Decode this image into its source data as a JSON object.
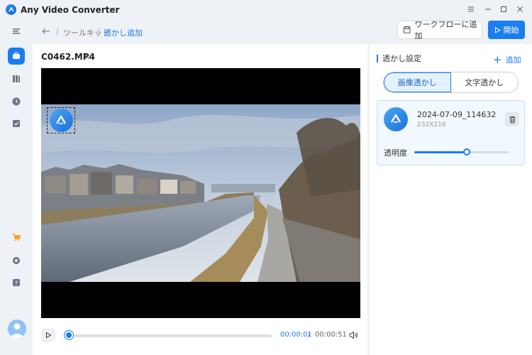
{
  "app": {
    "title": "Any Video Converter"
  },
  "header": {
    "breadcrumb": [
      "ツールキット",
      "透かし追加"
    ],
    "breadcrumb_sep": "/",
    "workflow_label": "ワークフローに追加",
    "start_label": "開始"
  },
  "editor": {
    "file_name": "C0462.MP4",
    "close_glyph": "×",
    "time_current": "00:00:01",
    "time_sep": "/",
    "time_total": "00:00:51",
    "progress": 0.02
  },
  "panel": {
    "title": "透かし設定",
    "add_label": "追加",
    "tabs": [
      {
        "label": "画像透かし",
        "active": true
      },
      {
        "label": "文字透かし",
        "active": false
      }
    ],
    "watermark": {
      "name": "2024-07-09_114632",
      "size": "232X218",
      "opacity_label": "透明度",
      "opacity": 0.56
    }
  },
  "colors": {
    "accent": "#1a7df0",
    "bg": "#eef1f6"
  },
  "icons": [
    "menu-icon",
    "toolbox-icon",
    "library-icon",
    "history-icon",
    "task-icon",
    "cart-icon",
    "settings-icon",
    "help-icon",
    "user-avatar"
  ]
}
